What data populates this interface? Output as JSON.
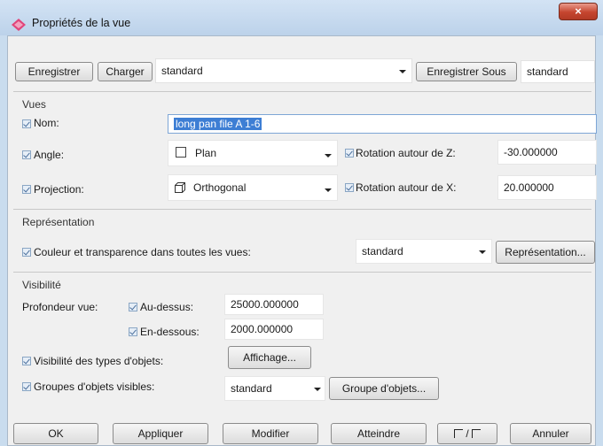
{
  "window": {
    "title": "Propriétés de la vue",
    "close_label": "×"
  },
  "toolbar": {
    "save_label": "Enregistrer",
    "load_label": "Charger",
    "preset_value": "standard",
    "save_as_label": "Enregistrer Sous",
    "save_as_value": "standard"
  },
  "views": {
    "group_label": "Vues",
    "name_label": "Nom:",
    "name_value": "long pan file A 1-6",
    "angle_label": "Angle:",
    "angle_value": "Plan",
    "rotation_z_label": "Rotation autour de Z:",
    "rotation_z_value": "-30.000000",
    "projection_label": "Projection:",
    "projection_value": "Orthogonal",
    "rotation_x_label": "Rotation autour de X:",
    "rotation_x_value": "20.000000"
  },
  "representation": {
    "group_label": "Représentation",
    "color_label": "Couleur et transparence dans toutes les vues:",
    "color_value": "standard",
    "button_label": "Représentation..."
  },
  "visibility": {
    "group_label": "Visibilité",
    "depth_label": "Profondeur vue:",
    "above_label": "Au-dessus:",
    "above_value": "25000.000000",
    "below_label": "En-dessous:",
    "below_value": "2000.000000",
    "types_label": "Visibilité des types d'objets:",
    "display_button": "Affichage...",
    "groups_label": "Groupes d'objets visibles:",
    "groups_value": "standard",
    "groups_button": "Groupe d'objets..."
  },
  "footer": {
    "ok_label": "OK",
    "apply_label": "Appliquer",
    "modify_label": "Modifier",
    "reach_label": "Atteindre",
    "toggle_label": "/",
    "cancel_label": "Annuler"
  }
}
